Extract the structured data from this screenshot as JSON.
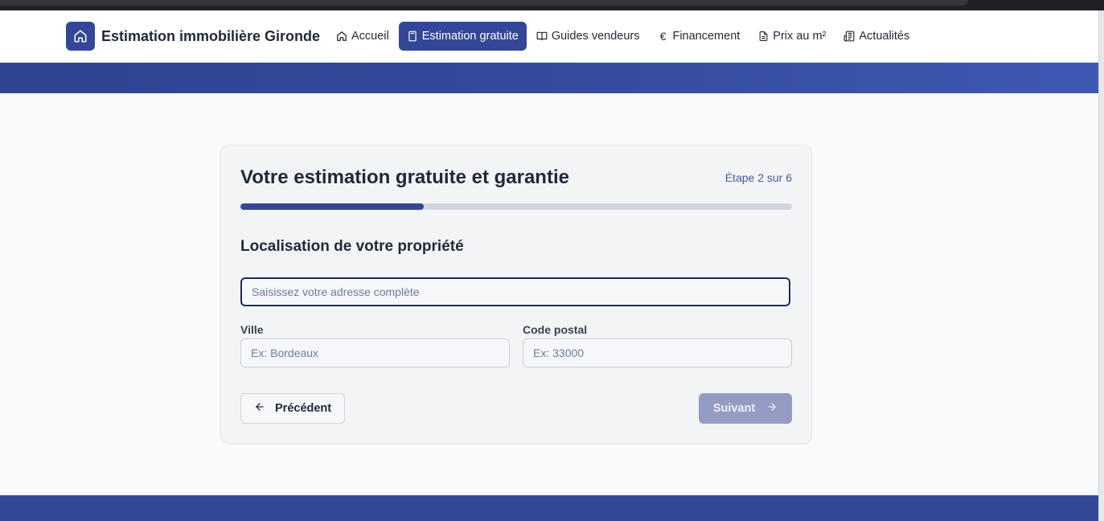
{
  "brand": {
    "title": "Estimation immobilière Gironde",
    "logo_icon": "home-icon",
    "color": "#334796"
  },
  "nav": {
    "items": [
      {
        "label": "Accueil",
        "icon": "home-icon",
        "active": false
      },
      {
        "label": "Estimation gratuite",
        "icon": "calculator-icon",
        "active": true
      },
      {
        "label": "Guides vendeurs",
        "icon": "book-open-icon",
        "active": false
      },
      {
        "label": "Financement",
        "icon": "euro-icon",
        "active": false
      },
      {
        "label": "Prix au m²",
        "icon": "file-text-icon",
        "active": false
      },
      {
        "label": "Actualités",
        "icon": "newspaper-icon",
        "active": false
      }
    ]
  },
  "form": {
    "title": "Votre estimation gratuite et garantie",
    "step_label": "Étape 2 sur 6",
    "progress_fraction": 0.333,
    "section_title": "Localisation de votre propriété",
    "address": {
      "placeholder": "Saisissez votre adresse complète",
      "value": ""
    },
    "city": {
      "label": "Ville",
      "placeholder": "Ex: Bordeaux",
      "value": ""
    },
    "postal": {
      "label": "Code postal",
      "placeholder": "Ex: 33000",
      "value": ""
    },
    "prev_button": "Précédent",
    "next_button": "Suivant"
  },
  "colors": {
    "primary": "#334796",
    "next_disabled": "#949cc4",
    "background": "#f8fafb"
  }
}
